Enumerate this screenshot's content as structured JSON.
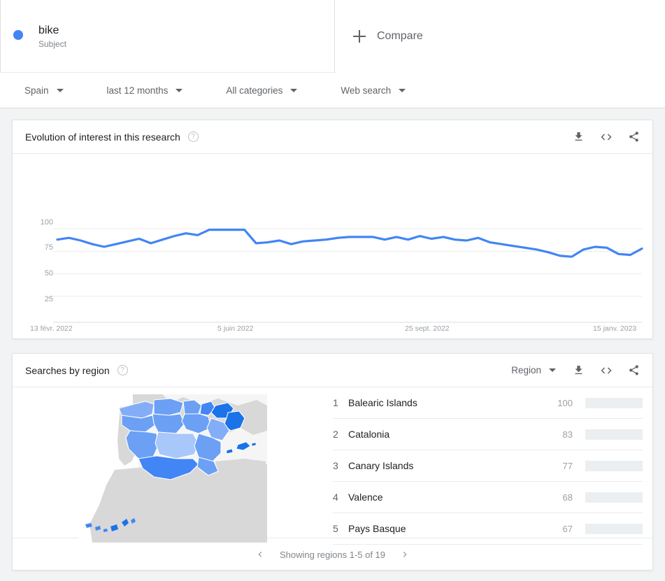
{
  "header": {
    "term": {
      "name": "bike",
      "subtitle": "Subject",
      "dot_color": "#4285f4"
    },
    "compare_label": "Compare",
    "plus_icon": "plus-icon"
  },
  "filters": [
    {
      "label": "Spain",
      "icon": "chevron-down-icon"
    },
    {
      "label": "last 12 months",
      "icon": "chevron-down-icon"
    },
    {
      "label": "All categories",
      "icon": "chevron-down-icon"
    },
    {
      "label": "Web search",
      "icon": "chevron-down-icon"
    }
  ],
  "timeseries_card": {
    "title": "Evolution of interest in this research",
    "help_icon": "?",
    "actions": [
      "download-icon",
      "embed-icon",
      "share-icon"
    ]
  },
  "region_card": {
    "title": "Searches by region",
    "help_icon": "?",
    "sort_label": "Region",
    "actions": [
      "download-icon",
      "embed-icon",
      "share-icon"
    ],
    "rows": [
      {
        "rank": "1",
        "name": "Balearic Islands",
        "value": "100",
        "pct": 100
      },
      {
        "rank": "2",
        "name": "Catalonia",
        "value": "83",
        "pct": 83
      },
      {
        "rank": "3",
        "name": "Canary Islands",
        "value": "77",
        "pct": 77
      },
      {
        "rank": "4",
        "name": "Valence",
        "value": "68",
        "pct": 68
      },
      {
        "rank": "5",
        "name": "Pays Basque",
        "value": "67",
        "pct": 67
      }
    ],
    "pager": {
      "text": "Showing regions 1-5 of 19",
      "prev_icon": "chevron-left-icon",
      "next_icon": "chevron-right-icon"
    }
  },
  "chart_data": {
    "type": "line",
    "title": "Evolution of interest in this research",
    "xlabel": "",
    "ylabel": "",
    "ylim": [
      0,
      108
    ],
    "yticks": [
      25,
      50,
      75,
      100
    ],
    "ytick_labels": [
      "25",
      "50",
      "75",
      "100"
    ],
    "grid": true,
    "legend": "none",
    "line_color": "#4285f4",
    "x_tick_labels": [
      "13 févr. 2022",
      "5 juin 2022",
      "25 sept. 2022",
      "15 janv. 2023"
    ],
    "x_tick_positions": [
      0,
      16,
      32,
      48
    ],
    "series": [
      {
        "name": "bike",
        "values": [
          88,
          90,
          87,
          83,
          80,
          83,
          86,
          89,
          84,
          88,
          92,
          95,
          93,
          99,
          99,
          99,
          99,
          84,
          85,
          87,
          83,
          86,
          87,
          88,
          90,
          91,
          91,
          91,
          88,
          91,
          88,
          92,
          89,
          91,
          88,
          87,
          90,
          85,
          83,
          81,
          79,
          77,
          74,
          70,
          69,
          77,
          80,
          79,
          72,
          71,
          78
        ]
      }
    ]
  },
  "map": {
    "name": "spain-choropleth",
    "colors": {
      "ocean": "#ffffff",
      "background": "#f5f5f5",
      "neutral_land": "#d8d8d8",
      "scale": [
        "#e8f0fe",
        "#a8c7fa",
        "#83aef7",
        "#6ba0f5",
        "#4285f4",
        "#1a73e8"
      ]
    }
  }
}
